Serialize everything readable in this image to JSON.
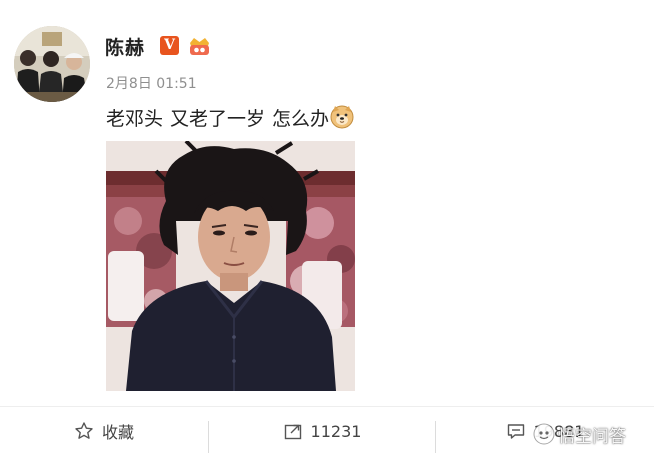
{
  "user": {
    "name": "陈赫",
    "verified_mark": "V"
  },
  "post": {
    "time": "2月8日 01:51",
    "text_part1": "老邓头",
    "text_part2": "又老了一岁",
    "text_part3": "怎么办",
    "emoji": "doge-icon"
  },
  "actions": {
    "favorite_label": "收藏",
    "repost_count": "11231",
    "comment_count": "19881"
  },
  "watermark": {
    "text": "悟空问答"
  },
  "colors": {
    "verified": "#e8541e",
    "time": "#8f8f8f",
    "text": "#222222",
    "icon": "#555555"
  }
}
